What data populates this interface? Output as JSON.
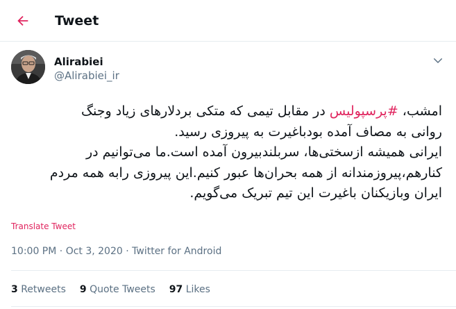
{
  "header": {
    "title": "Tweet",
    "back_icon": "arrow-left-icon",
    "accent_color": "#e0245e"
  },
  "author": {
    "name": "Alirabiei",
    "handle": "@Alirabiei_ir",
    "more_icon": "chevron-down-icon"
  },
  "tweet": {
    "line1_before": "امشب، ",
    "hashtag": "#پرسپولیس",
    "line1_after": " در مقابل تیمی که متکی بردلارهای زیاد وجنگ",
    "line2": "روانی به مصاف آمده بودباغیرت به پیروزی رسید.",
    "line3": "ایرانی همیشه ازسختی‌ها، سربلندبیرون آمده است.ما می‌توانیم در",
    "line4": "کنارهم،پیروزمندانه از همه بحران‌ها عبور کنیم.این پیروزی رابه همه مردم",
    "line5": "ایران وبازیکنان باغیرت این تیم تبریک می‌گویم.",
    "translate_label": "Translate Tweet",
    "time": "10:00 PM",
    "date": "Oct 3, 2020",
    "separator": " · ",
    "source": "Twitter for Android"
  },
  "stats": {
    "retweets_count": "3",
    "retweets_label": "Retweets",
    "quotes_count": "9",
    "quotes_label": "Quote Tweets",
    "likes_count": "97",
    "likes_label": "Likes"
  }
}
